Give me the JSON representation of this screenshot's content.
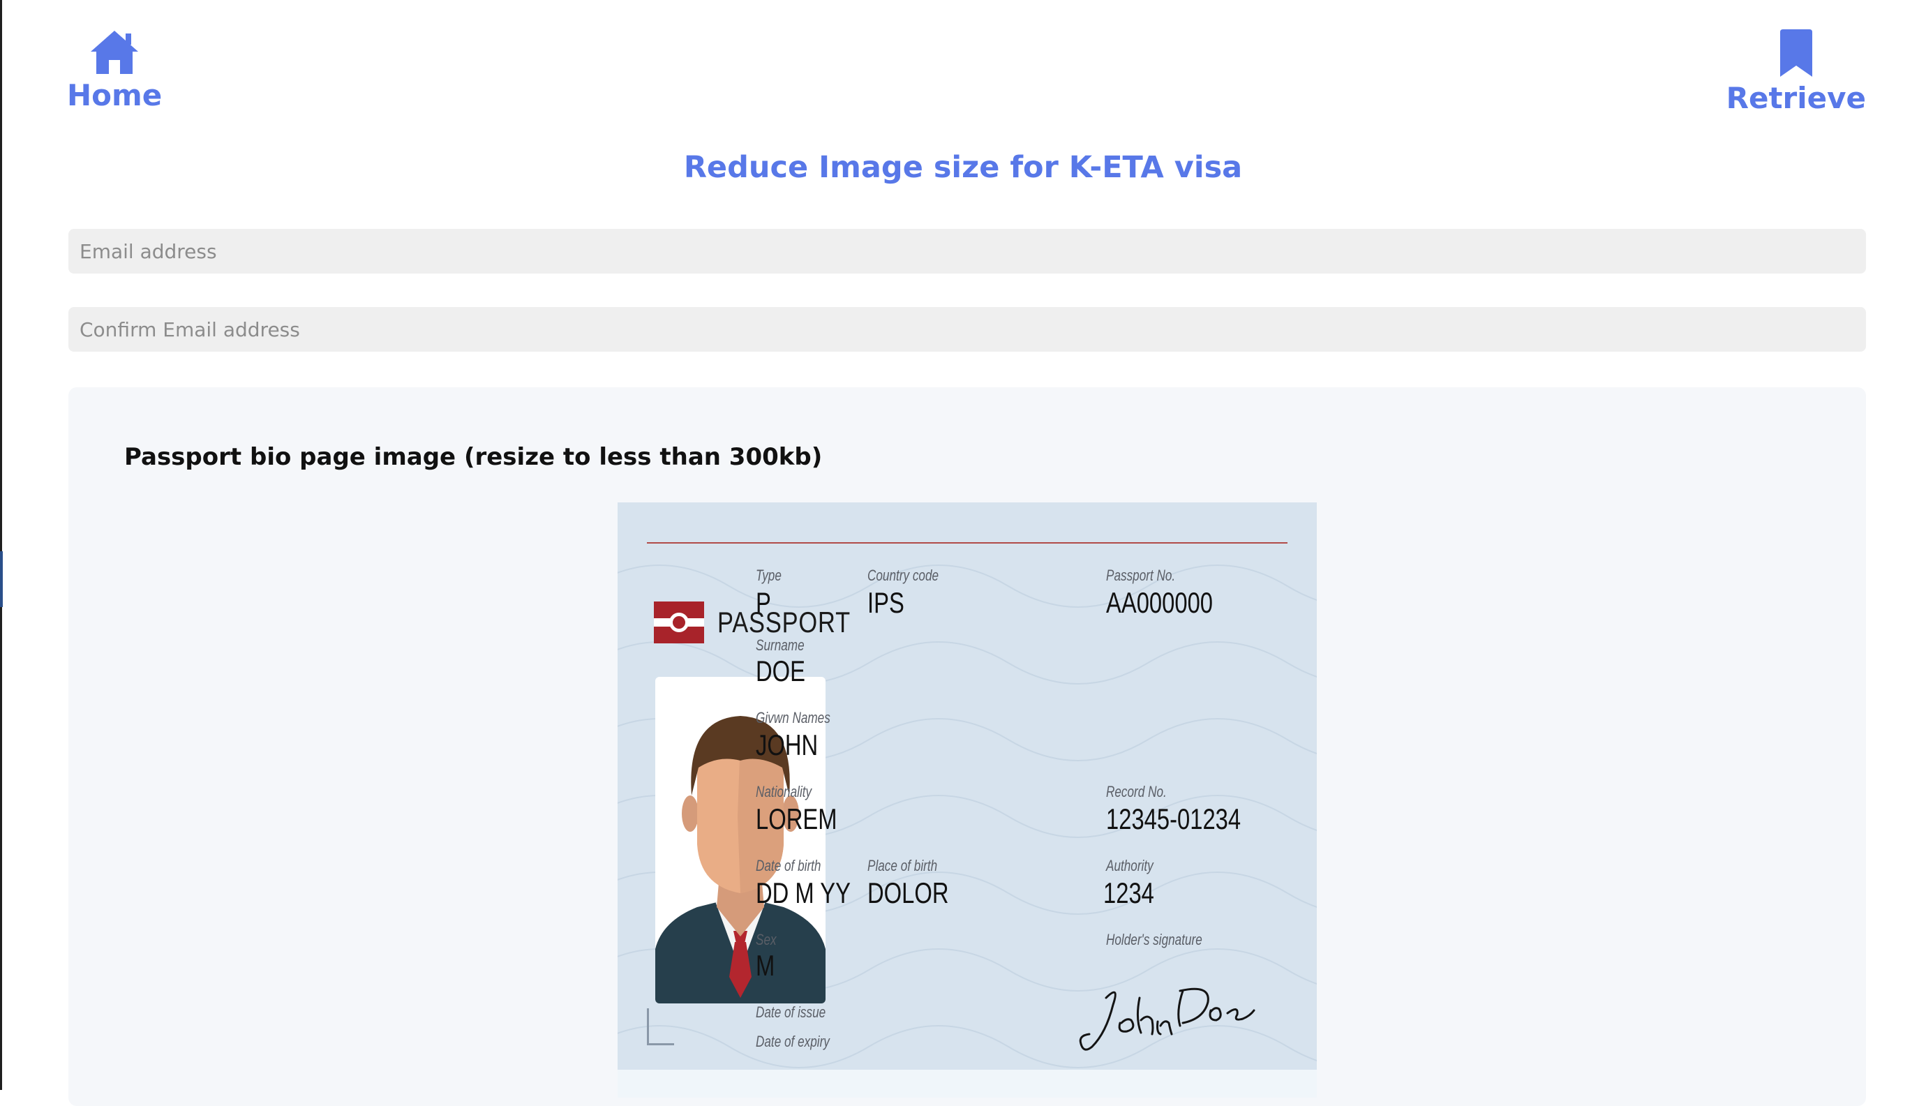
{
  "nav": {
    "home_label": "Home",
    "home_icon": "home-icon",
    "retrieve_label": "Retrieve",
    "retrieve_icon": "bookmark-icon"
  },
  "page_title": "Reduce Image size for K-ETA visa",
  "form": {
    "email_placeholder": "Email address",
    "email_value": "",
    "confirm_placeholder": "Confirm Email address",
    "confirm_value": ""
  },
  "upload": {
    "label": "Passport bio page image (resize to less than 300kb)"
  },
  "passport": {
    "header": "PASSPORT",
    "fields": {
      "type_label": "Type",
      "type_value": "P",
      "country_label": "Country code",
      "country_value": "IPS",
      "passport_no_label": "Passport No.",
      "passport_no_value": "AA000000",
      "surname_label": "Surname",
      "surname_value": "DOE",
      "given_label": "Givwn Names",
      "given_value": "JOHN",
      "nationality_label": "Nationality",
      "nationality_value": "LOREM",
      "record_label": "Record No.",
      "record_value": "12345-01234",
      "dob_label": "Date of birth",
      "dob_value": "DD M YY",
      "pob_label": "Place of birth",
      "pob_value": "DOLOR",
      "authority_label": "Authority",
      "authority_value": "1234",
      "sex_label": "Sex",
      "sex_value": "M",
      "signature_label": "Holder's signature",
      "issue_label": "Date of issue",
      "expiry_label": "Date of expiry"
    },
    "signature_text": "John Doe"
  },
  "colors": {
    "accent": "#5878e8",
    "field_bg": "#efefef",
    "panel_bg": "#f5f7fa",
    "passport_bg": "#d7e3ee",
    "passport_red": "#a8232a"
  }
}
